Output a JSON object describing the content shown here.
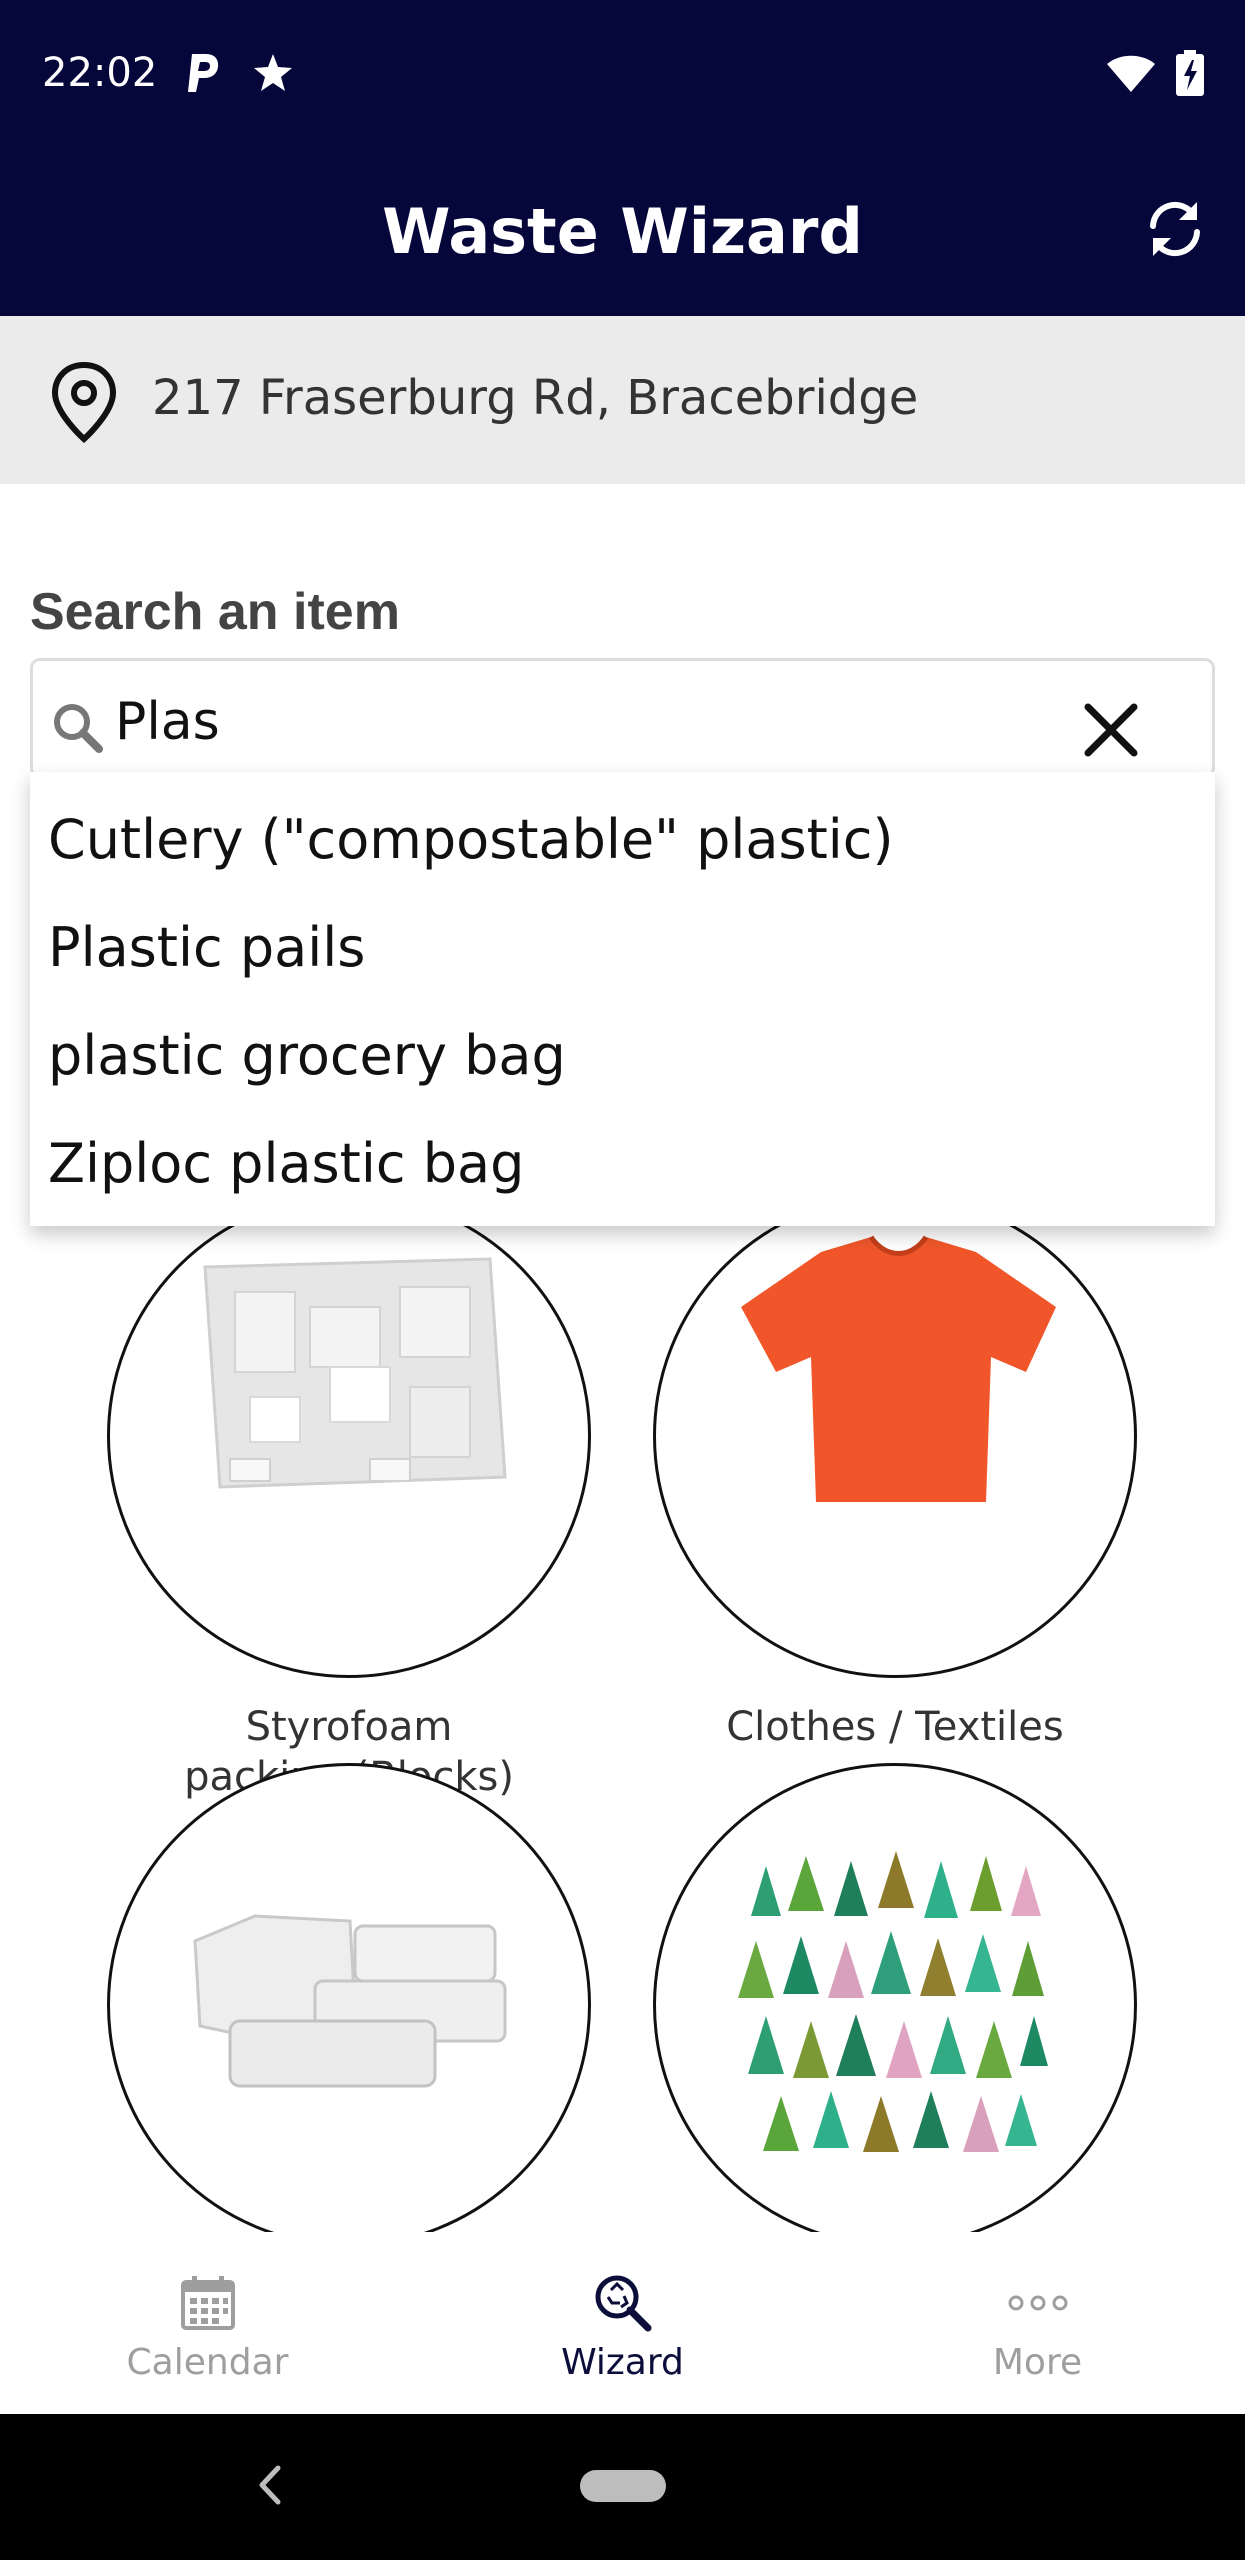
{
  "status_bar": {
    "time": "22:02",
    "icons": [
      "parking-icon",
      "star-icon",
      "wifi-icon",
      "battery-charging-icon"
    ]
  },
  "header": {
    "title": "Waste Wizard",
    "refresh_icon": "refresh-icon"
  },
  "location": {
    "icon": "location-pin-icon",
    "address": "217 Fraserburg Rd, Bracebridge"
  },
  "search": {
    "label": "Search an item",
    "value": "Plas",
    "placeholder": "",
    "suggestions": [
      "Cutlery (\"compostable\" plastic)",
      "Plastic pails",
      "plastic grocery bag",
      "Ziploc plastic bag"
    ]
  },
  "categories": [
    {
      "label_line1": "Styrofoam",
      "label_line2": "packing (Blocks)"
    },
    {
      "label_line1": "Clothes / Textiles",
      "label_line2": ""
    },
    {
      "label_line1": "",
      "label_line2": ""
    },
    {
      "label_line1": "",
      "label_line2": ""
    }
  ],
  "bottom_nav": {
    "items": [
      {
        "label": "Calendar",
        "icon": "calendar-icon",
        "active": false
      },
      {
        "label": "Wizard",
        "icon": "wizard-search-icon",
        "active": true
      },
      {
        "label": "More",
        "icon": "more-dots-icon",
        "active": false
      }
    ]
  },
  "colors": {
    "header_bg": "#05063a",
    "location_bg": "#ebebeb",
    "nav_active": "#0b0d3a",
    "nav_inactive": "#9e9e9e",
    "tshirt": "#f0562a"
  }
}
